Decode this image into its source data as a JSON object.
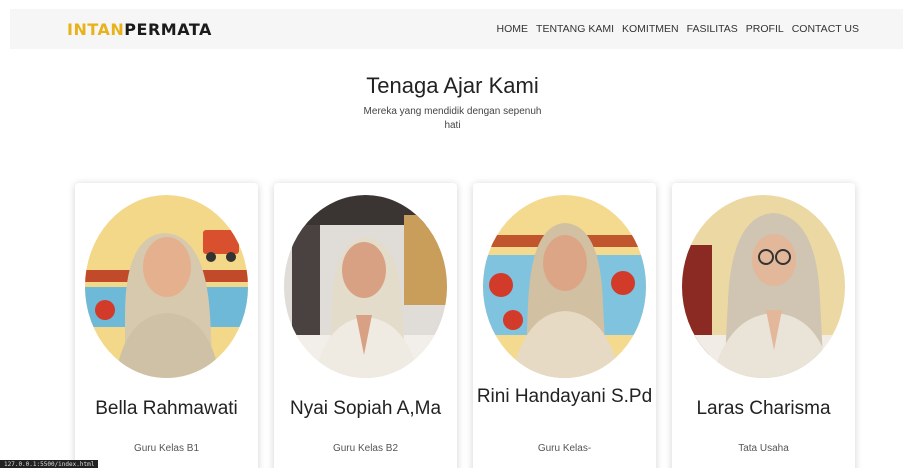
{
  "brand": {
    "part1": "INTAN",
    "part2": "PERMATA"
  },
  "nav": [
    "HOME",
    "TENTANG KAMI",
    "KOMITMEN",
    "FASILITAS",
    "PROFIL",
    "CONTACT US"
  ],
  "section": {
    "title": "Tenaga Ajar Kami",
    "subtitle": "Mereka yang mendidik dengan sepenuh hati"
  },
  "teachers": [
    {
      "name": "Bella Rahmawati",
      "role": "Guru Kelas B1"
    },
    {
      "name": "Nyai Sopiah A,Ma",
      "role": "Guru Kelas B2"
    },
    {
      "name": "Rini Handayani S.Pd",
      "role": "Guru Kelas-"
    },
    {
      "name": "Laras Charisma",
      "role": "Tata Usaha"
    }
  ],
  "status_text": "127.0.0.1:5500/index.html",
  "colors": {
    "accent": "#e8b21a",
    "navbar_bg": "#f6f6f7"
  }
}
